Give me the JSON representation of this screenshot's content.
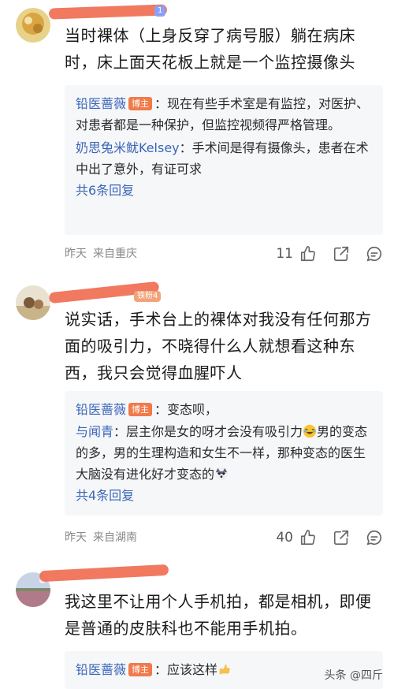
{
  "comments": [
    {
      "fan_badge": "1",
      "text": "当时裸体（上身反穿了病号服）躺在病床时，床上面天花板上就是一个监控摄像头",
      "replies": [
        {
          "name": "铅医蔷薇",
          "tag": "博主",
          "sep": "：",
          "text": "现在有些手术室是有监控，对医护、对患者都是一种保护，但监控视频得严格管理。"
        },
        {
          "name": "奶思兔米鱿Kelsey",
          "tag": "",
          "sep": "：",
          "text": "手术间是得有摄像头，患者在术中出了意外，有证可求"
        }
      ],
      "more": "共6条回复",
      "time": "昨天",
      "location": "来自重庆",
      "likes": "11"
    },
    {
      "fan_badge": "铁粉4",
      "text": "说实话，手术台上的裸体对我没有任何那方面的吸引力，不晓得什么人就想看这种东西，我只会觉得血腥吓人",
      "replies": [
        {
          "name": "铅医蔷薇",
          "tag": "博主",
          "sep": "：",
          "text": "变态呗，"
        },
        {
          "name": "与闻青",
          "tag": "",
          "sep": "：",
          "text": "层主你是女的呀才会没有吸引力",
          "text2": "男的变态的多，男的生理构造和女生不一样，那种变态的医生大脑没有进化好才变态的"
        }
      ],
      "more": "共4条回复",
      "time": "昨天",
      "location": "来自湖南",
      "likes": "40"
    },
    {
      "fan_badge": "",
      "text": "我这里不让用个人手机拍，都是相机，即便是普通的皮肤科也不能用手机拍。",
      "replies": [
        {
          "name": "铅医蔷薇",
          "tag": "博主",
          "sep": "：",
          "text": "应该这样"
        }
      ]
    }
  ],
  "watermark": "头条 @四斤",
  "icons": [
    "thumb-up-icon",
    "share-icon",
    "comment-icon",
    "laugh-cry-emoji",
    "husky-emoji",
    "thumb-emoji"
  ],
  "colors": {
    "link": "#3a66b8",
    "blogger_tag": "#f07a4a",
    "reply_bg": "#f6f7f9",
    "redaction": "#f06a4e"
  }
}
